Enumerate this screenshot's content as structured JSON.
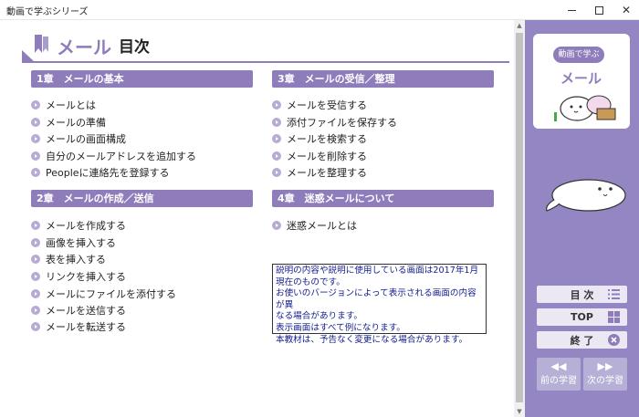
{
  "window": {
    "title": "動画で学ぶシリーズ"
  },
  "header": {
    "section": "メール",
    "title": "目次"
  },
  "chapters": [
    {
      "title": "1章　メールの基本",
      "items": [
        "メールとは",
        "メールの準備",
        "メールの画面構成",
        "自分のメールアドレスを追加する",
        "Peopleに連絡先を登録する"
      ]
    },
    {
      "title": "2章　メールの作成／送信",
      "items": [
        "メールを作成する",
        "画像を挿入する",
        "表を挿入する",
        "リンクを挿入する",
        "メールにファイルを添付する",
        "メールを送信する",
        "メールを転送する"
      ]
    },
    {
      "title": "3章　メールの受信／整理",
      "items": [
        "メールを受信する",
        "添付ファイルを保存する",
        "メールを検索する",
        "メールを削除する",
        "メールを整理する"
      ]
    },
    {
      "title": "4章　迷惑メールについて",
      "items": [
        "迷惑メールとは"
      ]
    }
  ],
  "notice": {
    "lines": [
      "説明の内容や説明に使用している画面は2017年1月",
      "現在のものです。",
      "お使いのバージョンによって表示される画面の内容が異",
      "なる場合があります。",
      "表示画面はすべて例になります。",
      "本教材は、予告なく変更になる場合があります。"
    ]
  },
  "sidebar": {
    "logo_bubble": "動画で学ぶ",
    "logo_title": "メール",
    "buttons": {
      "toc": "目 次",
      "top": "TOP",
      "exit": "終 了",
      "prev": "前の学習",
      "next": "次の学習"
    }
  },
  "colors": {
    "accent": "#8f7cba",
    "sidebar": "#9386c2",
    "notice_text": "#17208f"
  }
}
